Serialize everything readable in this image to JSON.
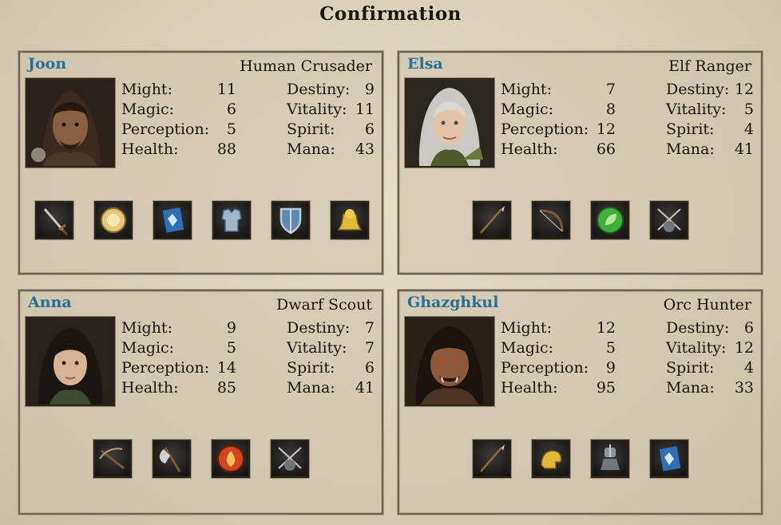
{
  "title": "Confirmation",
  "stat_labels": {
    "might": "Might:",
    "magic": "Magic:",
    "perception": "Perception:",
    "health": "Health:",
    "destiny": "Destiny:",
    "vitality": "Vitality:",
    "spirit": "Spirit:",
    "mana": "Mana:"
  },
  "characters": [
    {
      "name": "Joon",
      "class": "Human Crusader",
      "might": "11",
      "magic": "6",
      "perception": "5",
      "health": "88",
      "destiny": "9",
      "vitality": "11",
      "spirit": "6",
      "mana": "43",
      "items": [
        "sword-icon",
        "amulet-icon",
        "scroll-icon",
        "chest-armor-icon",
        "shield-icon",
        "gauntlet-icon"
      ]
    },
    {
      "name": "Elsa",
      "class": "Elf Ranger",
      "might": "7",
      "magic": "8",
      "perception": "12",
      "health": "66",
      "destiny": "12",
      "vitality": "5",
      "spirit": "4",
      "mana": "41",
      "items": [
        "spear-icon",
        "bow-icon",
        "nature-orb-icon",
        "dual-wield-icon"
      ]
    },
    {
      "name": "Anna",
      "class": "Dwarf Scout",
      "might": "9",
      "magic": "5",
      "perception": "14",
      "health": "85",
      "destiny": "7",
      "vitality": "7",
      "spirit": "6",
      "mana": "41",
      "items": [
        "crossbow-icon",
        "axe-icon",
        "fire-orb-icon",
        "dual-wield-icon"
      ]
    },
    {
      "name": "Ghazghkul",
      "class": "Orc Hunter",
      "might": "12",
      "magic": "5",
      "perception": "9",
      "health": "95",
      "destiny": "6",
      "vitality": "12",
      "spirit": "4",
      "mana": "33",
      "items": [
        "spear-icon",
        "strength-icon",
        "knight-icon",
        "scroll-icon"
      ]
    }
  ],
  "colors": {
    "name": "#2a6f94",
    "text": "#1a1612",
    "panel_border": "#6e6556",
    "background": "#ddd4bf"
  }
}
